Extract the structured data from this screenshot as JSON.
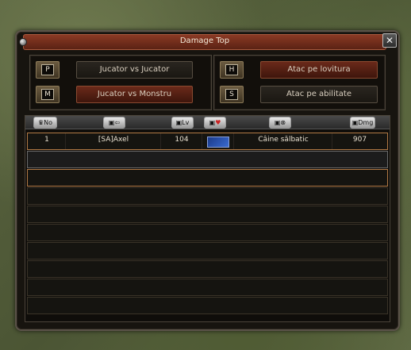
{
  "window": {
    "title": "Damage Top"
  },
  "left_group": {
    "options": [
      {
        "key": "P",
        "label": "Jucator vs Jucator",
        "active": false
      },
      {
        "key": "M",
        "label": "Jucator vs Monstru",
        "active": true
      }
    ]
  },
  "right_group": {
    "options": [
      {
        "key": "H",
        "label": "Atac pe lovitura",
        "active": true
      },
      {
        "key": "S",
        "label": "Atac pe abilitate",
        "active": false
      }
    ]
  },
  "table": {
    "headers": [
      {
        "icon": "crown-icon",
        "label": "No"
      },
      {
        "icon": "player-icon",
        "label": ""
      },
      {
        "icon": "level-icon",
        "label": "Lv"
      },
      {
        "icon": "empire-icon",
        "label": ""
      },
      {
        "icon": "target-icon",
        "label": ""
      },
      {
        "icon": "damage-icon",
        "label": "Dmg"
      }
    ],
    "rows": [
      {
        "no": "1",
        "name": "[SA]Axel",
        "level": "104",
        "target": "Câine sălbatic",
        "damage": "907"
      }
    ]
  }
}
